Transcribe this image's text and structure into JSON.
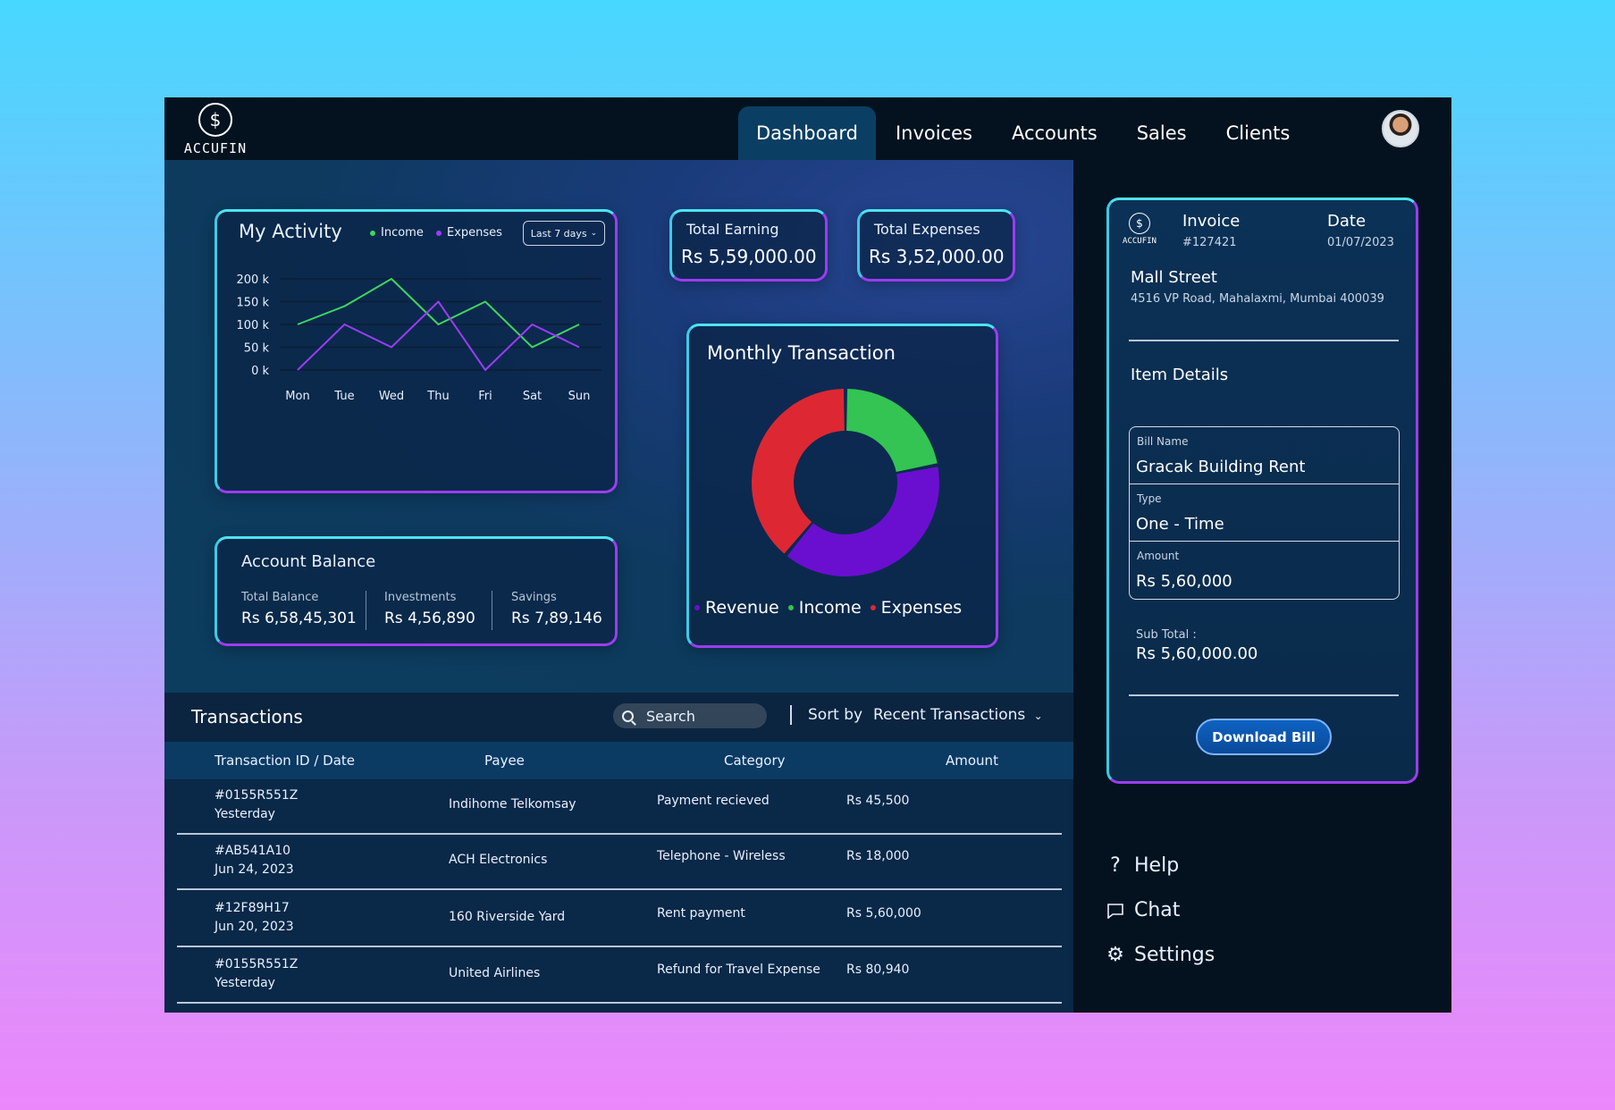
{
  "brand": {
    "logo_glyph": "$",
    "name": "ACCUFIN"
  },
  "nav": {
    "items": [
      "Dashboard",
      "Invoices",
      "Accounts",
      "Sales",
      "Clients"
    ],
    "active": "Dashboard"
  },
  "activity": {
    "title": "My Activity",
    "legend_income": "Income",
    "legend_expenses": "Expenses",
    "range": "Last 7 days",
    "chart_data": {
      "type": "line",
      "categories": [
        "Mon",
        "Tue",
        "Wed",
        "Thu",
        "Fri",
        "Sat",
        "Sun"
      ],
      "series": [
        {
          "name": "Income",
          "color": "#3fd460",
          "values": [
            100,
            140,
            200,
            100,
            150,
            50,
            100
          ]
        },
        {
          "name": "Expenses",
          "color": "#9a3cf5",
          "values": [
            0,
            100,
            50,
            150,
            0,
            100,
            50
          ]
        }
      ],
      "yticks": [
        "200 k",
        "150 k",
        "100 k",
        "50 k",
        "0 k"
      ],
      "ylim": [
        0,
        200
      ],
      "grid": true
    }
  },
  "stats": {
    "earning_label": "Total Earning",
    "earning_value": "Rs 5,59,000.00",
    "expenses_label": "Total Expenses",
    "expenses_value": "Rs 3,52,000.00"
  },
  "balance": {
    "title": "Account Balance",
    "total_label": "Total Balance",
    "total_value": "Rs 6,58,45,301",
    "investments_label": "Investments",
    "investments_value": "Rs 4,56,890",
    "savings_label": "Savings",
    "savings_value": "Rs 7,89,146"
  },
  "monthly": {
    "title": "Monthly Transaction",
    "legend": [
      "Revenue",
      "Income",
      "Expenses"
    ],
    "chart_data": {
      "type": "pie",
      "donut": true,
      "slices": [
        {
          "name": "Income",
          "color": "#33c453",
          "value": 22
        },
        {
          "name": "Revenue",
          "color": "#6a0fd0",
          "value": 39
        },
        {
          "name": "Expenses",
          "color": "#dd2833",
          "value": 39
        }
      ]
    }
  },
  "transactions": {
    "title": "Transactions",
    "search_placeholder": "Search",
    "sort_label": "Sort by",
    "sort_value": "Recent Transactions",
    "headers": [
      "Transaction ID / Date",
      "Payee",
      "Category",
      "Amount"
    ],
    "rows": [
      {
        "id": "#0155R551Z",
        "date": "Yesterday",
        "payee": "Indihome Telkomsay",
        "category": "Payment recieved",
        "amount": "Rs 45,500"
      },
      {
        "id": "#AB541A10",
        "date": "Jun 24, 2023",
        "payee": "ACH Electronics",
        "category": "Telephone - Wireless",
        "amount": "Rs 18,000"
      },
      {
        "id": "#12F89H17",
        "date": "Jun 20, 2023",
        "payee": "160 Riverside Yard",
        "category": "Rent payment",
        "amount": "Rs 5,60,000"
      },
      {
        "id": "#0155R551Z",
        "date": "Yesterday",
        "payee": "United Airlines",
        "category": "Refund for Travel Expense",
        "amount": "Rs 80,940"
      }
    ]
  },
  "invoice": {
    "logo_text": "ACCUFIN",
    "invoice_label": "Invoice",
    "invoice_no": "#127421",
    "date_label": "Date",
    "date_value": "01/07/2023",
    "street": "Mall Street",
    "address": "4516 VP Road, Mahalaxmi, Mumbai 400039",
    "item_details": "Item Details",
    "bill_name_label": "Bill Name",
    "bill_name_value": "Gracak Building Rent",
    "type_label": "Type",
    "type_value": "One - Time",
    "amount_label": "Amount",
    "amount_value": "Rs 5,60,000",
    "subtotal_label": "Sub Total :",
    "subtotal_value": "Rs 5,60,000.00",
    "download_label": "Download Bill"
  },
  "side_links": {
    "help": "Help",
    "chat": "Chat",
    "settings": "Settings"
  }
}
